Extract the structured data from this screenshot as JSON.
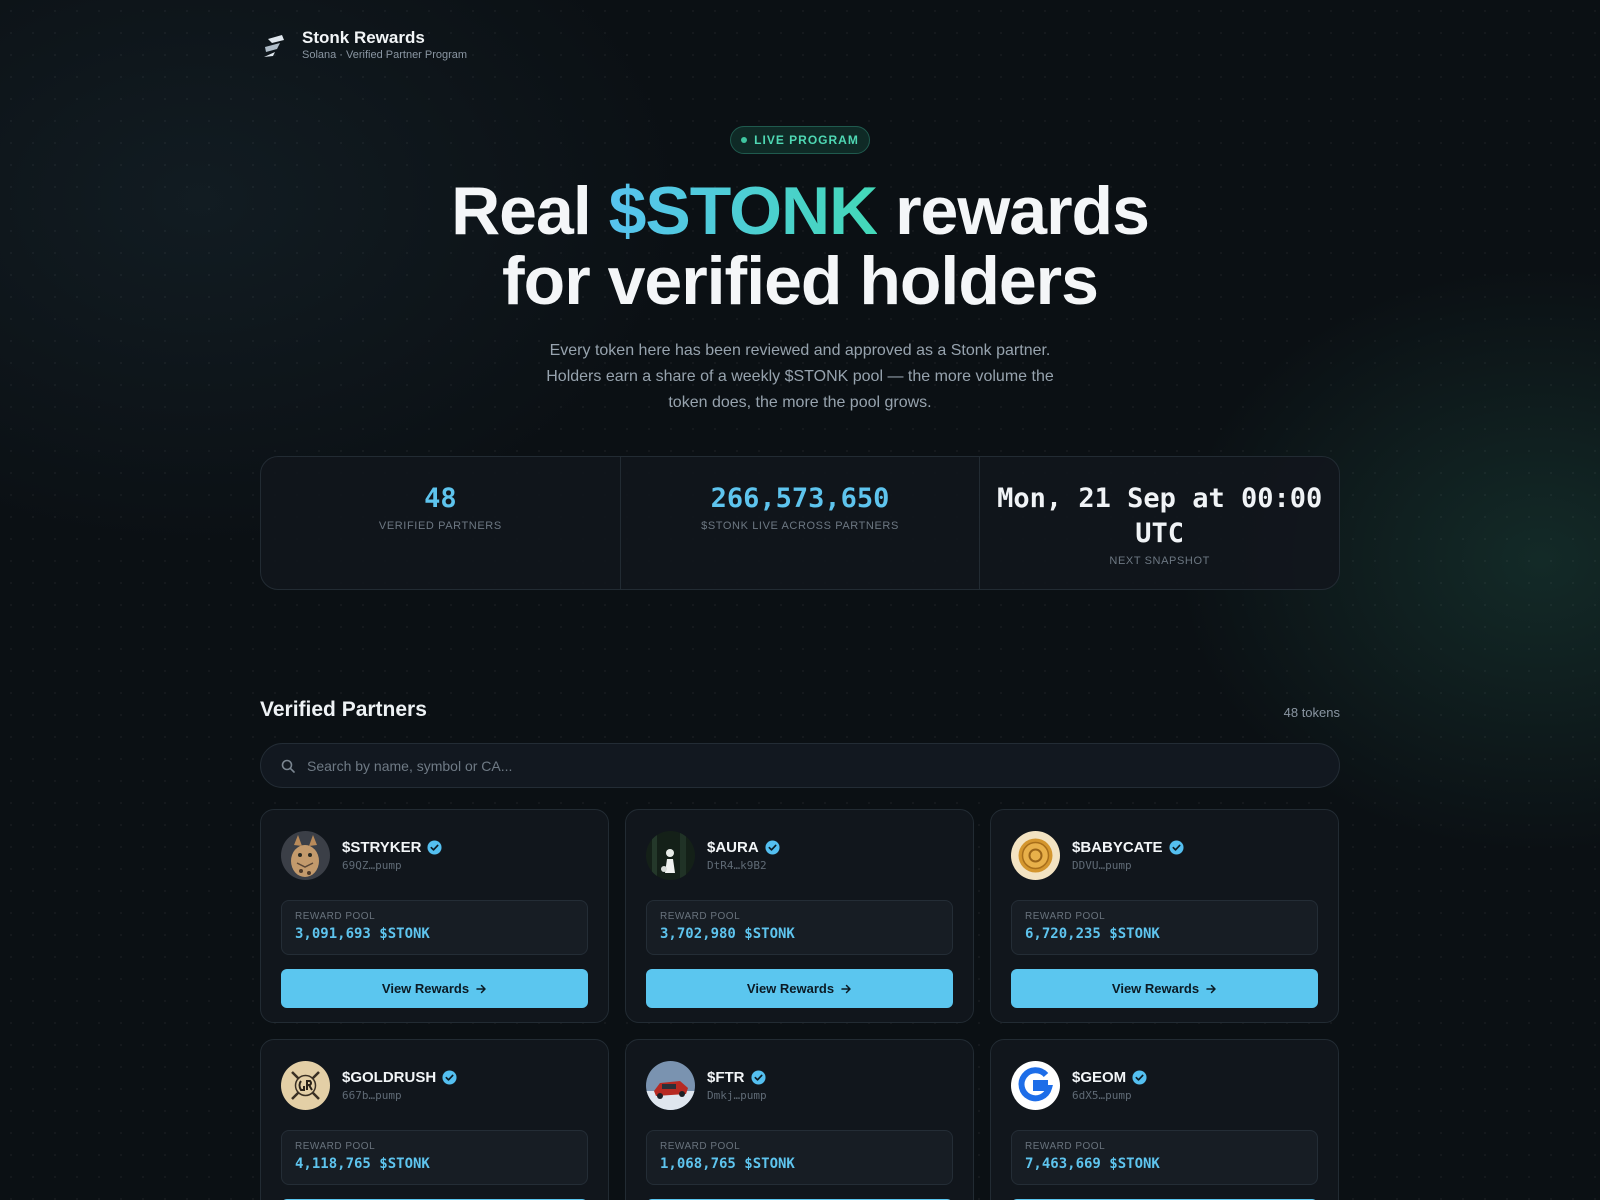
{
  "brand": {
    "title": "Stonk Rewards",
    "subtitle": "Solana · Verified Partner Program"
  },
  "hero": {
    "badge": "LIVE PROGRAM",
    "title_pre": "Real ",
    "title_accent": "$STONK",
    "title_post": " rewards",
    "title_line2": "for verified holders",
    "description": "Every token here has been reviewed and approved as a Stonk partner. Holders earn a share of a weekly $STONK pool — the more volume the token does, the more the pool grows."
  },
  "stats": [
    {
      "value": "48",
      "label": "VERIFIED PARTNERS"
    },
    {
      "value": "266,573,650",
      "label": "$STONK LIVE ACROSS PARTNERS"
    },
    {
      "value": "Mon, 21 Sep at 00:00 UTC",
      "label": "NEXT SNAPSHOT"
    }
  ],
  "partners": {
    "title": "Verified Partners",
    "count": "48 tokens",
    "search_placeholder": "Search by name, symbol or CA...",
    "pool_label": "REWARD POOL",
    "button_label": "View Rewards",
    "cards": [
      {
        "symbol": "$STRYKER",
        "ca": "69QZ…pump",
        "pool": "3,091,693 $STONK",
        "avatar": "cat-photo"
      },
      {
        "symbol": "$AURA",
        "ca": "DtR4…k9B2",
        "pool": "3,702,980 $STONK",
        "avatar": "forest-figure"
      },
      {
        "symbol": "$BABYCATE",
        "ca": "DDVU…pump",
        "pool": "6,720,235 $STONK",
        "avatar": "gold-coin"
      },
      {
        "symbol": "$GOLDRUSH",
        "ca": "667b…pump",
        "pool": "4,118,765 $STONK",
        "avatar": "gr-monogram"
      },
      {
        "symbol": "$FTR",
        "ca": "Dmkj…pump",
        "pool": "1,068,765 $STONK",
        "avatar": "red-car"
      },
      {
        "symbol": "$GEOM",
        "ca": "6dX5…pump",
        "pool": "7,463,669 $STONK",
        "avatar": "g-logo"
      }
    ]
  },
  "colors": {
    "accent": "#5bc6ef",
    "accent_green": "#43d9b8",
    "background": "#0b1014",
    "card": "#11161c"
  },
  "icons": {
    "verified": "verified-check-icon",
    "search": "search-icon",
    "arrow": "arrow-right-icon",
    "logo": "stonk-logo-icon"
  }
}
